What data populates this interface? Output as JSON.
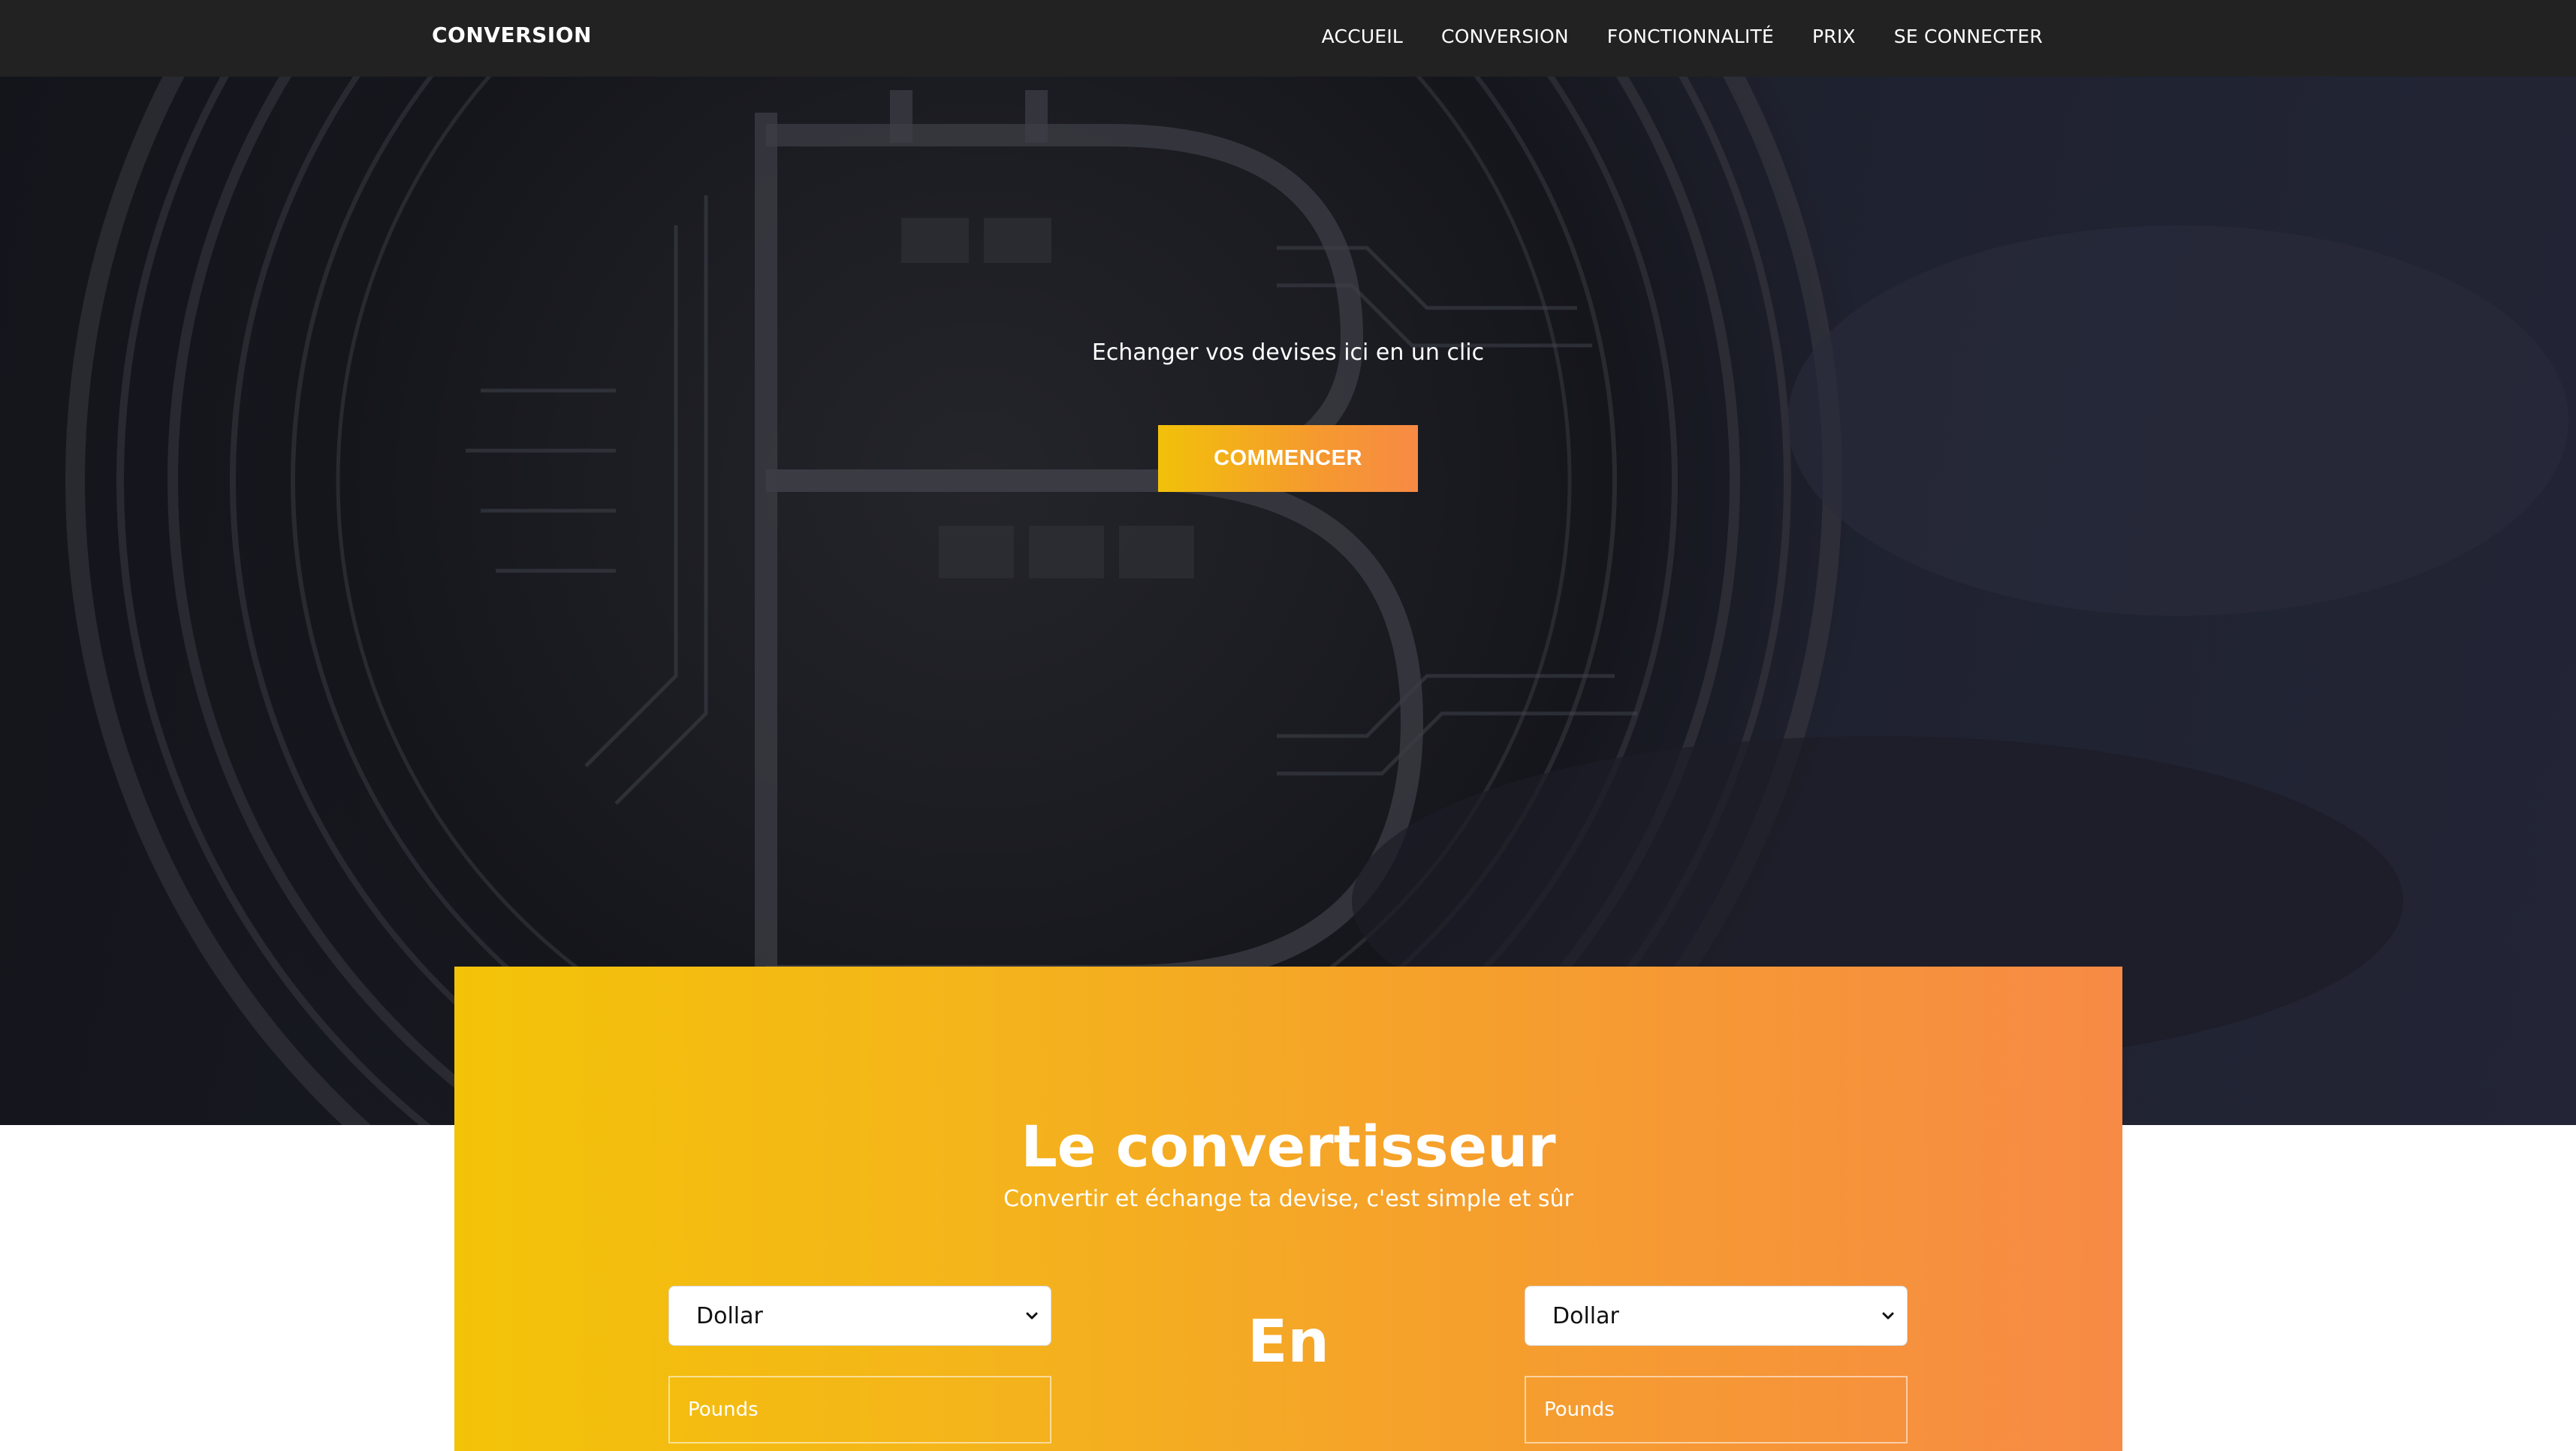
{
  "nav": {
    "brand": "CONVERSION",
    "links": [
      "ACCUEIL",
      "CONVERSION",
      "FONCTIONNALITÉ",
      "PRIX",
      "SE CONNECTER"
    ]
  },
  "hero": {
    "tagline": "Echanger vos devises ici en un clic",
    "cta_label": "COMMENCER"
  },
  "converter": {
    "title": "Le convertisseur",
    "subtitle": "Convertir et échange ta devise, c'est simple et sûr",
    "from_currency": "Dollar",
    "to_currency": "Dollar",
    "separator": "En",
    "from_placeholder": "Pounds",
    "to_placeholder": "Pounds"
  },
  "colors": {
    "nav_bg": "#222222",
    "accent_start": "#f3c308",
    "accent_end": "#f78a45"
  }
}
